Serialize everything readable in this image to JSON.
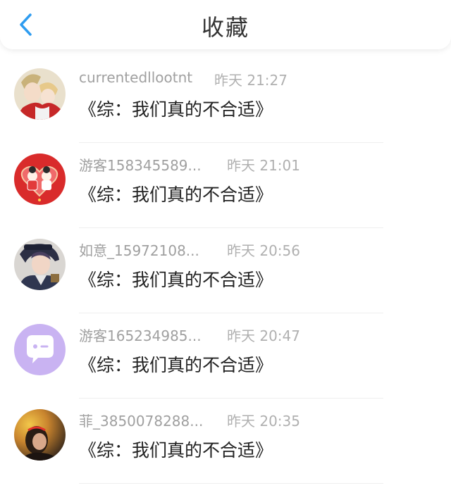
{
  "header": {
    "title": "收藏",
    "back_icon": "chevron-left-icon",
    "accent_color": "#2e9cf0"
  },
  "favorites": [
    {
      "user": "currentedllootnt",
      "time": "昨天 21:27",
      "work": "《综：我们真的不合适》",
      "avatar": "anime-couple-avatar"
    },
    {
      "user": "游客158345589...",
      "time": "昨天 21:01",
      "work": "《综：我们真的不合适》",
      "avatar": "red-cartoon-avatar"
    },
    {
      "user": "如意_15972108...",
      "time": "昨天 20:56",
      "work": "《综：我们真的不合适》",
      "avatar": "anime-boy-avatar"
    },
    {
      "user": "游客165234985...",
      "time": "昨天 20:47",
      "work": "《综：我们真的不合适》",
      "avatar": "chat-bubble-avatar"
    },
    {
      "user": "菲_3850078288...",
      "time": "昨天 20:35",
      "work": "《综：我们真的不合适》",
      "avatar": "photo-avatar"
    }
  ]
}
